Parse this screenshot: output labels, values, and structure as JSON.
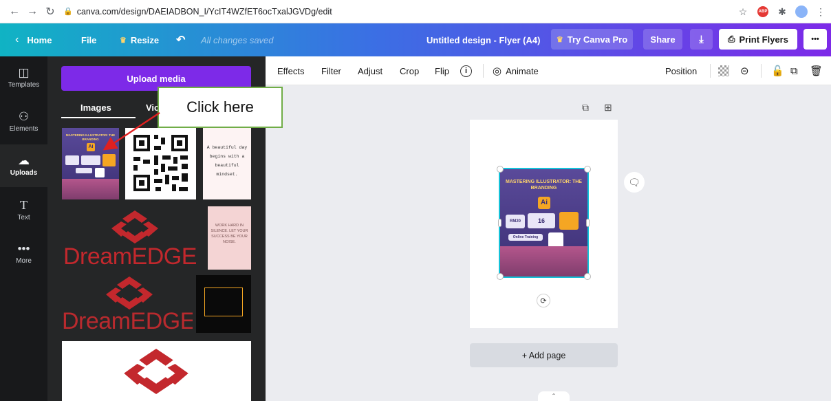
{
  "browser": {
    "url": "canva.com/design/DAEIADBON_I/YcIT4WZfET6ocTxalJGVDg/edit",
    "extensions": [
      "star-icon",
      "adblock-icon",
      "puzzle-icon",
      "avatar",
      "kebab-menu-icon"
    ],
    "adblock_label": "ABP"
  },
  "topbar": {
    "home": "Home",
    "file": "File",
    "resize": "Resize",
    "saved_status": "All changes saved",
    "design_title": "Untitled design - Flyer (A4)",
    "try_pro": "Try Canva Pro",
    "share": "Share",
    "print": "Print Flyers",
    "more": "•••"
  },
  "rail": [
    {
      "label": "Templates",
      "icon": "templates-icon"
    },
    {
      "label": "Elements",
      "icon": "elements-icon"
    },
    {
      "label": "Uploads",
      "icon": "uploads-icon",
      "active": true
    },
    {
      "label": "Text",
      "icon": "text-icon"
    },
    {
      "label": "More",
      "icon": "more-icon"
    }
  ],
  "panel": {
    "upload_button": "Upload media",
    "tabs": [
      "Images",
      "Vic"
    ],
    "thumbs": {
      "flyer_header": "MASTERING ILLUSTRATOR: THE BRANDING",
      "flyer_badge": "Ai",
      "text_card": "A beautiful day begins with a beautiful mindset.",
      "pink_card": "WORK HARD IN SILENCE. LET YOUR SUCCESS BE YOUR NOISE.",
      "logo_text": "DreamEDGE"
    }
  },
  "context_toolbar": {
    "effects": "Effects",
    "filter": "Filter",
    "adjust": "Adjust",
    "crop": "Crop",
    "flip": "Flip",
    "animate": "Animate",
    "position": "Position"
  },
  "canvas": {
    "image_header": "MASTERING ILLUSTRATOR: THE BRANDING",
    "image_badge": "Ai",
    "price": "RM20",
    "count": "16",
    "training": "Online Training",
    "add_page": "+ Add page"
  },
  "annotation": {
    "callout_text": "Click here",
    "border_color": "#70ad47",
    "arrow_color": "#e02020"
  },
  "colors": {
    "brand_purple": "#7d2ae8",
    "brand_teal": "#10b3c4",
    "selection": "#13c2d9"
  }
}
